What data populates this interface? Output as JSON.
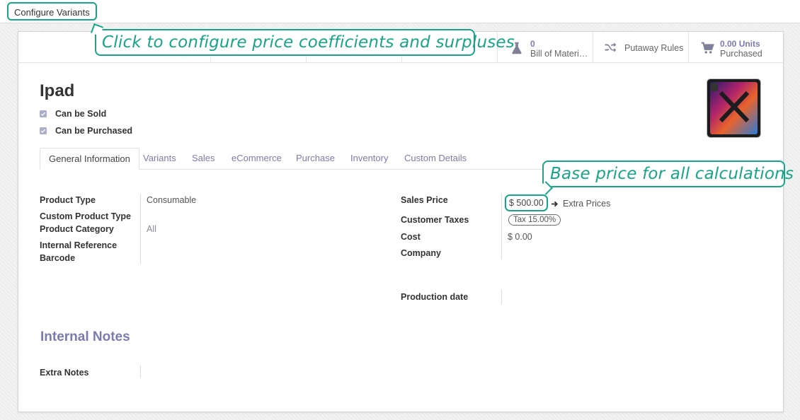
{
  "top_bar": {
    "configure_variants_label": "Configure Variants"
  },
  "smart_buttons": {
    "bom": {
      "count": "0",
      "label": "Bill of Materi…",
      "icon": "flask-icon"
    },
    "putaway": {
      "label": "Putaway Rules",
      "icon": "shuffle-icon"
    },
    "purchased": {
      "count": "0.00 Units",
      "label": "Purchased",
      "icon": "cart-icon"
    }
  },
  "product": {
    "name": "Ipad",
    "can_be_sold": {
      "label": "Can be Sold",
      "checked": true
    },
    "can_be_purchased": {
      "label": "Can be Purchased",
      "checked": true
    }
  },
  "tabs": [
    "General Information",
    "Variants",
    "Sales",
    "eCommerce",
    "Purchase",
    "Inventory",
    "Custom Details"
  ],
  "active_tab": "General Information",
  "left_fields": {
    "product_type": {
      "label": "Product Type",
      "value": "Consumable"
    },
    "custom_product_type": {
      "label": "Custom Product Type",
      "value": ""
    },
    "product_category": {
      "label": "Product Category",
      "value": "All"
    },
    "internal_reference": {
      "label": "Internal Reference",
      "value": ""
    },
    "barcode": {
      "label": "Barcode",
      "value": ""
    }
  },
  "right_fields": {
    "sales_price": {
      "label": "Sales Price",
      "value": "$ 500.00",
      "extra_prices_label": "Extra Prices"
    },
    "customer_taxes": {
      "label": "Customer Taxes",
      "value": "Tax 15.00%"
    },
    "cost": {
      "label": "Cost",
      "value": "$ 0.00"
    },
    "company": {
      "label": "Company",
      "value": ""
    },
    "production_date": {
      "label": "Production date",
      "value": ""
    }
  },
  "internal_notes": {
    "title": "Internal Notes",
    "extra_notes_label": "Extra Notes"
  },
  "callouts": {
    "configure": "Click to configure price coefficients and surpluses",
    "base_price": "Base price for all calculations"
  },
  "colors": {
    "accent": "#7c7bad",
    "highlight": "#17a589",
    "text": "#333333"
  }
}
